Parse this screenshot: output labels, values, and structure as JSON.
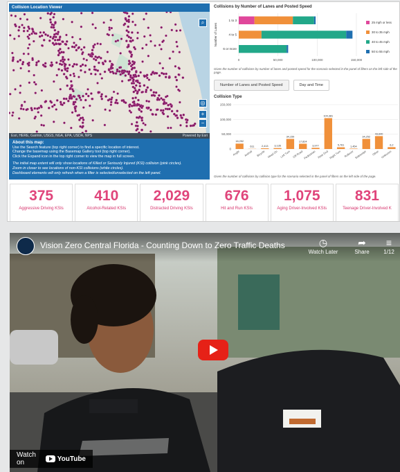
{
  "map": {
    "title": "Collision Location Viewer",
    "attribution_left": "Esri, HERE, Garmin, USGS, NGA, EPA, USDA, NPS",
    "attribution_right": "Powered by Esri",
    "about_title": "About this map:",
    "about_lines": [
      "Use the Search feature (top right corner) to find a specific location of interest.",
      "Change the basemap using the Basemap Gallery tool (top right corner).",
      "Click the Expand icon in the top right corner to view the map in full screen.",
      "The initial map extent will only show locations of Killed or Seriously Injured (KSI) collision (pink circles).",
      "Zoom in closer to see locations of non-KSI collisions (white circles).",
      "Dashboard elements will only refresh when a filter is selected/unselected on the left panel."
    ],
    "controls": {
      "search": "⌕",
      "locate": "◎",
      "zoom_in": "+",
      "zoom_out": "−"
    }
  },
  "chart1": {
    "title": "Collisions by Number of Lanes and Posted Speed",
    "note": "Gives the number of collisions by number of lanes and posted speed for the scenario selected in the panel of filters on the left side of the page."
  },
  "tabs": [
    "Number of Lanes and Posted Speed",
    "Day and Time"
  ],
  "chart2": {
    "title": "Collision Type",
    "note": "Gives the number of collisions by collision type for the scenario selected in the panel of filters on the left side of the page."
  },
  "chart_data": [
    {
      "type": "bar",
      "orientation": "horizontal",
      "stacked": true,
      "title": "Collisions by Number of Lanes and Posted Speed",
      "ylabel": "Number of Lanes",
      "categories": [
        "1 to 3",
        "4 to 5",
        "6 or more"
      ],
      "xlim": [
        0,
        150000
      ],
      "xticks": [
        "0",
        "50,000",
        "100,000",
        "150,000"
      ],
      "legend": "right",
      "series": [
        {
          "name": "25 mph or less",
          "color": "#e0479b",
          "values": [
            20000,
            0,
            0
          ]
        },
        {
          "name": "30 to 35 mph",
          "color": "#f0903a",
          "values": [
            49000,
            29000,
            0
          ]
        },
        {
          "name": "40 to 45 mph",
          "color": "#22a889",
          "values": [
            27000,
            108000,
            61000
          ]
        },
        {
          "name": "50 to 55 mph",
          "color": "#1f6fb0",
          "values": [
            2000,
            8000,
            2000
          ]
        }
      ]
    },
    {
      "type": "bar",
      "title": "Collision Type",
      "ylim": [
        0,
        150000
      ],
      "yticks": [
        "0",
        "50,000",
        "100,000",
        "150,000"
      ],
      "color": "#f0903a",
      "categories": [
        "Angle",
        "Animal",
        "Bicycle",
        "Head On",
        "Left Turn",
        "Off-Road",
        "Pedestrian",
        "Rear End",
        "Right Turn",
        "Rollover",
        "Sideswipe",
        "Other",
        "Unknown"
      ],
      "values": [
        18252,
        611,
        2413,
        3135,
        34159,
        17824,
        3977,
        104381,
        5761,
        1454,
        34252,
        43640,
        6200
      ],
      "labels": [
        "18,252",
        "611",
        "2,413",
        "3,135",
        "34,159",
        "17,824",
        "3,977",
        "104,381",
        "5,761",
        "1,454",
        "34,252",
        "43,640",
        "6,2"
      ]
    }
  ],
  "kpis": [
    {
      "value": "375",
      "label": "Aggressive Driving KSIs"
    },
    {
      "value": "410",
      "label": "Alcohol-Related KSIs"
    },
    {
      "value": "2,029",
      "label": "Distracted Driving KSIs"
    },
    {
      "value": "676",
      "label": "Hit and Run KSIs"
    },
    {
      "value": "1,075",
      "label": "Aging Driver-Involved KSIs"
    },
    {
      "value": "831",
      "label": "Teenage Driver-Involved K"
    }
  ],
  "video": {
    "title": "Vision Zero Central Florida - Counting Down to Zero Traffic Deaths",
    "watch_later": "Watch Later",
    "share": "Share",
    "counter": "1/12",
    "watch_on": "Watch on",
    "youtube": "YouTube",
    "icons": {
      "watch_later": "clock-icon",
      "share": "share-icon",
      "playlist": "playlist-icon"
    }
  },
  "colors": {
    "accent_blue": "#1f6fb0",
    "kpi_pink": "#e0457b",
    "youtube_red": "#e62117"
  }
}
